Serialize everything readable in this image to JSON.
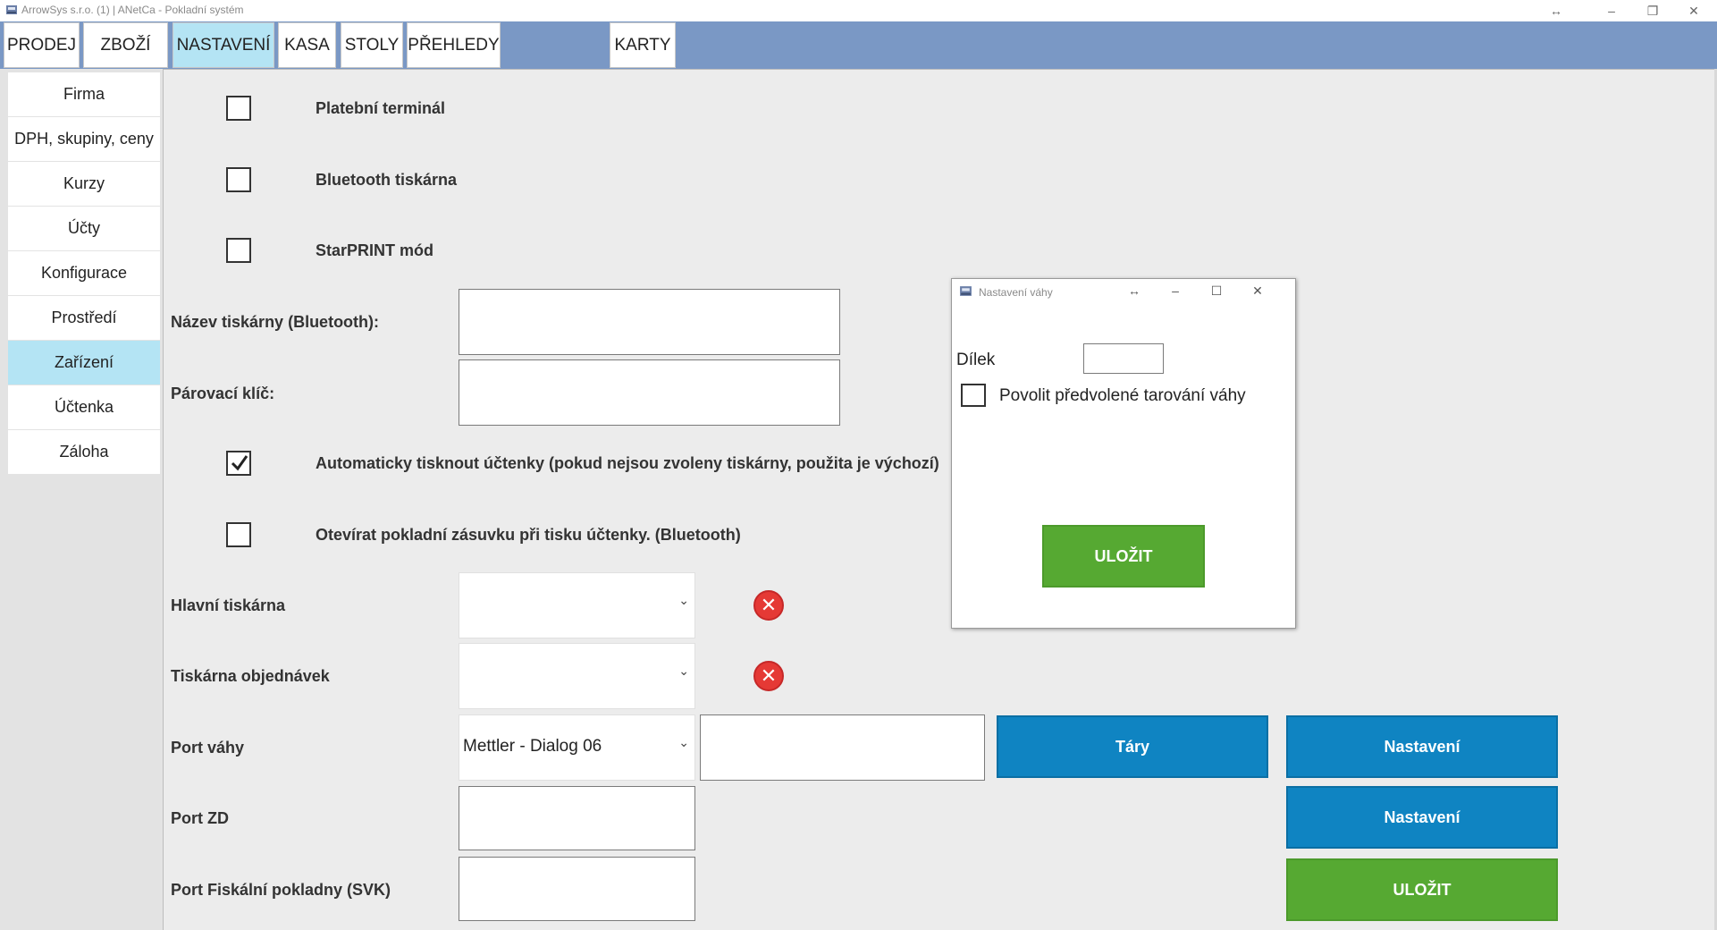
{
  "window": {
    "title": "ArrowSys s.r.o. (1) | ANetCa - Pokladní systém",
    "controls": [
      "↔",
      "–",
      "❐",
      "✕"
    ]
  },
  "menu": {
    "items": [
      {
        "label": "PRODEJ"
      },
      {
        "label": "ZBOŽÍ"
      },
      {
        "label": "NASTAVENÍ"
      },
      {
        "label": "KASA"
      },
      {
        "label": "STOLY"
      },
      {
        "label": "PŘEHLEDY"
      },
      {
        "label": "KARTY"
      }
    ],
    "active": "NASTAVENÍ"
  },
  "sidebar": {
    "items": [
      {
        "label": "Firma"
      },
      {
        "label": "DPH, skupiny, ceny"
      },
      {
        "label": "Kurzy"
      },
      {
        "label": "Účty"
      },
      {
        "label": "Konfigurace"
      },
      {
        "label": "Prostředí"
      },
      {
        "label": "Zařízení"
      },
      {
        "label": "Účtenka"
      },
      {
        "label": "Záloha"
      }
    ],
    "active": "Zařízení"
  },
  "settings": {
    "payment_terminal": {
      "label": "Platební terminál",
      "checked": false
    },
    "bt_printer": {
      "label": "Bluetooth tiskárna",
      "checked": false
    },
    "starprint": {
      "label": "StarPRINT mód",
      "checked": false
    },
    "printer_name": {
      "label": "Název tiskárny (Bluetooth):",
      "value": ""
    },
    "pairing_key": {
      "label": "Párovací klíč:",
      "value": ""
    },
    "auto_print": {
      "label": "Automaticky tisknout účtenky (pokud nejsou zvoleny tiskárny, použita je výchozí)",
      "checked": true
    },
    "open_drawer": {
      "label": "Otevírat pokladní zásuvku při tisku účtenky. (Bluetooth)",
      "checked": false
    },
    "main_printer": {
      "label": "Hlavní tiskárna",
      "value": ""
    },
    "order_printer": {
      "label": "Tiskárna objednávek",
      "value": ""
    },
    "scale_port": {
      "label": "Port váhy",
      "value": "Mettler - Dialog 06",
      "extra_value": ""
    },
    "zd_port": {
      "label": "Port ZD",
      "value": ""
    },
    "fiscal_port": {
      "label": "Port Fiskální pokladny (SVK)",
      "value": ""
    },
    "tare_button": "Táry",
    "settings_button_1": "Nastavení",
    "settings_button_2": "Nastavení",
    "save_button": "ULOŽIT",
    "clear_symbol": "✕",
    "combo_arrow": "⌄"
  },
  "dialog": {
    "title": "Nastavení váhy",
    "controls": [
      "↔",
      "–",
      "☐",
      "✕"
    ],
    "dilek_label": "Dílek",
    "dilek_value": "",
    "tare_checkbox": {
      "label": "Povolit předvolené tarování váhy",
      "checked": false
    },
    "save_button": "ULOŽIT"
  },
  "colors": {
    "menubar": "#7a98c5",
    "active_tab": "#b4e4f4",
    "blue_button": "#0f84c2",
    "green_button": "#56a932",
    "clear_red": "#e53935"
  }
}
